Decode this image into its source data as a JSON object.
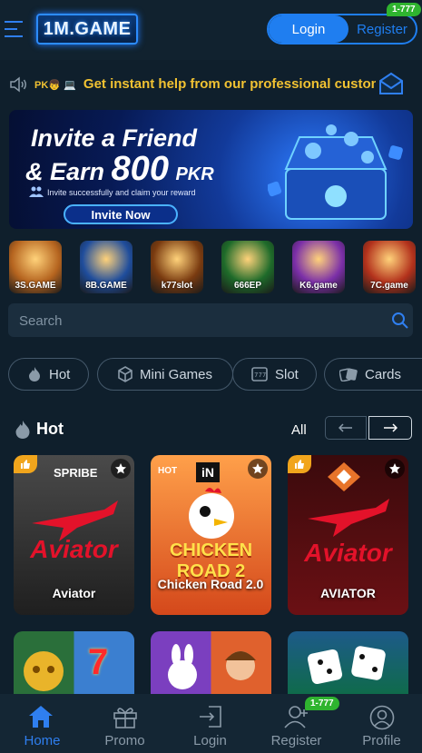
{
  "header": {
    "logo_text": "1M.GAME",
    "login_label": "Login",
    "register_label": "Register",
    "register_badge": "1-777"
  },
  "notice": {
    "prefix": "PK👦 💻",
    "text": "Get instant help from our professional customer service"
  },
  "banner": {
    "line1": "Invite a Friend",
    "line2_prefix": "& Earn",
    "amount": "800",
    "currency": "PKR",
    "subtitle": "Invite successfully and claim your reward",
    "cta": "Invite Now"
  },
  "brands": [
    {
      "label": "3S.GAME",
      "color": "#b5641f"
    },
    {
      "label": "8B.GAME",
      "color": "#1f4d9c"
    },
    {
      "label": "k77slot",
      "color": "#7a3b10"
    },
    {
      "label": "666EP",
      "color": "#1e6b2a"
    },
    {
      "label": "K6.game",
      "color": "#7b2fa8"
    },
    {
      "label": "7C.game",
      "color": "#b3321c"
    }
  ],
  "search": {
    "placeholder": "Search"
  },
  "categories": [
    {
      "label": "Hot",
      "icon": "flame-icon"
    },
    {
      "label": "Mini Games",
      "icon": "cube-icon"
    },
    {
      "label": "Slot",
      "icon": "slot-machine-icon"
    },
    {
      "label": "Cards",
      "icon": "cards-icon"
    }
  ],
  "section": {
    "title": "Hot",
    "all_label": "All"
  },
  "games": [
    {
      "name": "Aviator",
      "provider": "SPRIBE",
      "logo": "Aviator",
      "bg": "#3a3a3a"
    },
    {
      "name": "Chicken Road 2.0",
      "provider": "iN",
      "logo": "CHICKEN ROAD 2",
      "tag": "HOT",
      "bg": "#f0782a"
    },
    {
      "name": "AVIATOR",
      "provider": "",
      "logo": "Aviator",
      "bg": "#5a0f12"
    }
  ],
  "bottom_nav": {
    "home": "Home",
    "promo": "Promo",
    "login": "Login",
    "register": "Register",
    "register_badge": "1-777",
    "profile": "Profile"
  },
  "colors": {
    "accent": "#1f7ef0",
    "notice": "#f1c232",
    "badge": "#2fb42f",
    "background": "#0f1f2c"
  }
}
